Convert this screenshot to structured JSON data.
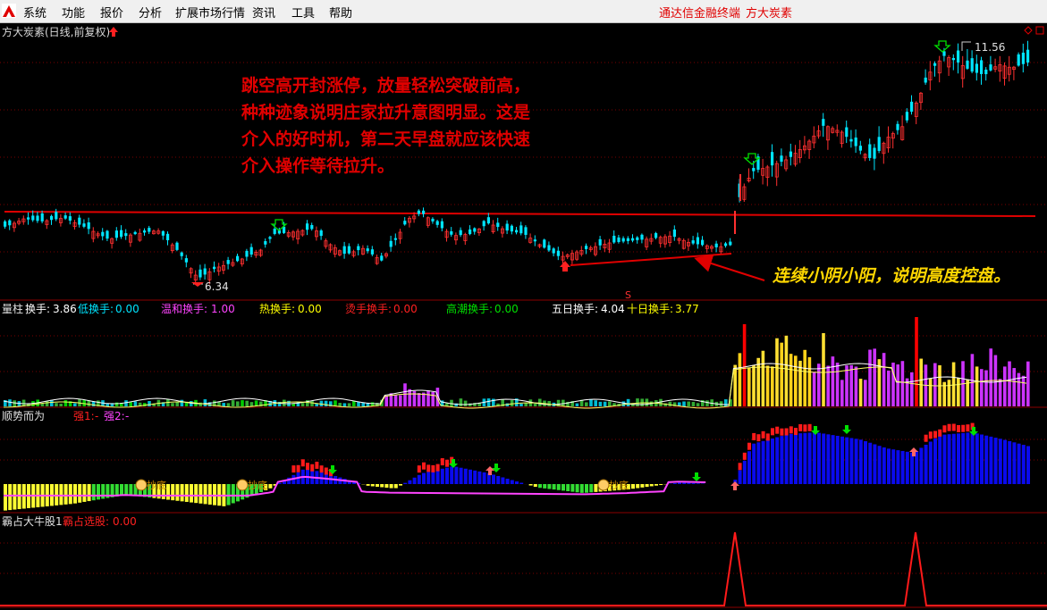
{
  "menubar": {
    "items": [
      "系统",
      "功能",
      "报价",
      "分析",
      "扩展市场行情",
      "资讯",
      "工具",
      "帮助"
    ],
    "right_titles": [
      "通达信金融终端",
      "方大炭素"
    ]
  },
  "main_panel": {
    "title": "方大炭素(日线,前复权)",
    "high_label": "11.56",
    "low_label": "6.34",
    "annotation_1": [
      "跳空高开封涨停，放量轻松突破前高，",
      "种种迹象说明庄家拉升意图明显。这是",
      "介入的好时机，第二天早盘就应该快速",
      "介入操作等待拉升。"
    ],
    "annotation_2": "连续小阴小阳，说明高度控盘。",
    "marker_s": "S"
  },
  "volume_panel": {
    "name": "量柱",
    "fields": [
      {
        "label": "换手:",
        "value": "3.86",
        "color": "#ffffff"
      },
      {
        "label": "低换手:",
        "value": "0.00",
        "color": "#00e5ff"
      },
      {
        "label": "温和换手:",
        "value": "1.00",
        "color": "#ff44ff"
      },
      {
        "label": "热换手:",
        "value": "0.00",
        "color": "#ffff00"
      },
      {
        "label": "烫手换手:",
        "value": "0.00",
        "color": "#ff2020"
      },
      {
        "label": "高潮换手:",
        "value": "0.00",
        "color": "#00e000"
      },
      {
        "label": "五日换手:",
        "value": "4.04",
        "color": "#ffffff"
      },
      {
        "label": "十日换手:",
        "value": "3.77",
        "color": "#ffff00"
      }
    ]
  },
  "trend_panel": {
    "name": "顺势而为",
    "fields": [
      {
        "label": "强1:",
        "value": "-",
        "color": "#ff2020"
      },
      {
        "label": "强2:",
        "value": "-",
        "color": "#ff44ff"
      }
    ],
    "bottom_tag": "抄底"
  },
  "bull_panel": {
    "name": "霸占大牛股1",
    "fields": [
      {
        "label": "霸占选股:",
        "value": "0.00",
        "color": "#ff2020"
      }
    ]
  },
  "chart_data": {
    "type": "candlestick",
    "title": "方大炭素(日线,前复权)",
    "price_range": [
      6.34,
      11.56
    ],
    "annotated_high": 11.56,
    "annotated_low": 6.34,
    "panels": [
      "K线",
      "量柱",
      "顺势而为",
      "霸占大牛股1"
    ],
    "indicators": {
      "换手": 3.86,
      "低换手": 0.0,
      "温和换手": 1.0,
      "热换手": 0.0,
      "烫手换手": 0.0,
      "高潮换手": 0.0,
      "五日换手": 4.04,
      "十日换手": 3.77,
      "霸占选股": 0.0
    },
    "colors": {
      "up": "#ff3030",
      "down": "#00e5ff",
      "horizontal_line": "#e00000",
      "volume_warm": "#cc33ff",
      "volume_hot": "#ffe033",
      "volume_top": "#ff0000",
      "trend_up": "#0a0aee",
      "trend_yellow": "#ffff33",
      "trend_red": "#ff1a1a"
    }
  }
}
